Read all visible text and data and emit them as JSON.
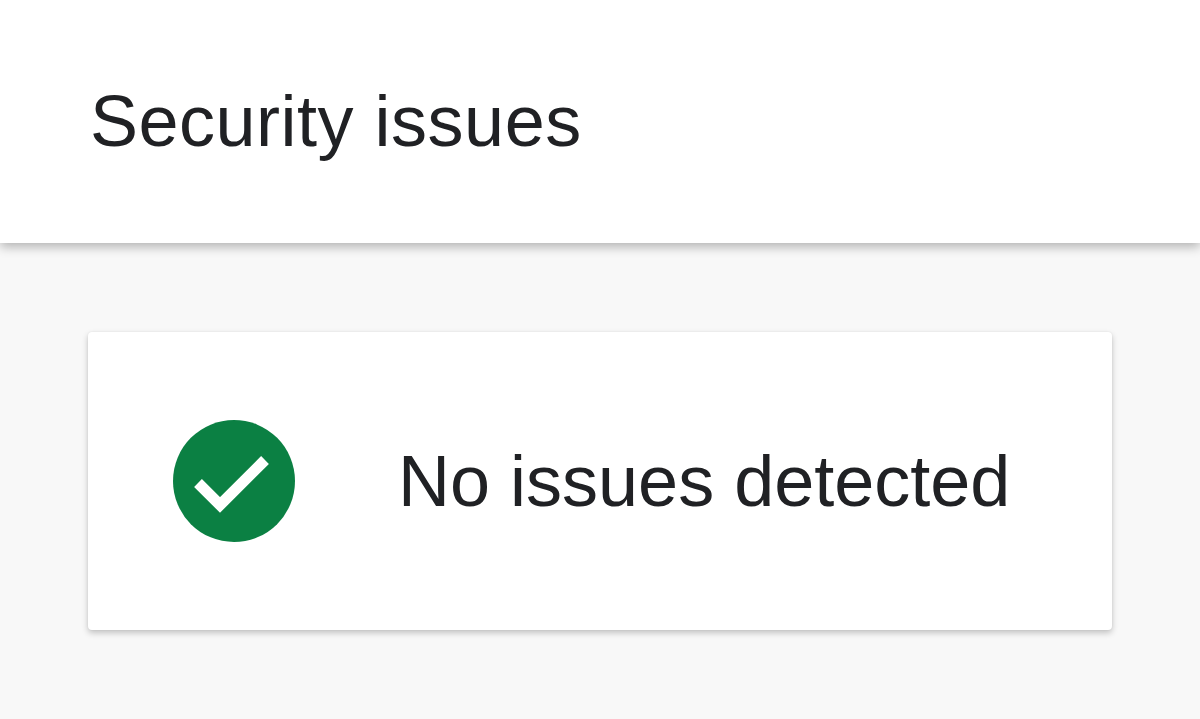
{
  "app_bar": {
    "title": "Security issues"
  },
  "status_card": {
    "message": "No issues detected"
  }
}
